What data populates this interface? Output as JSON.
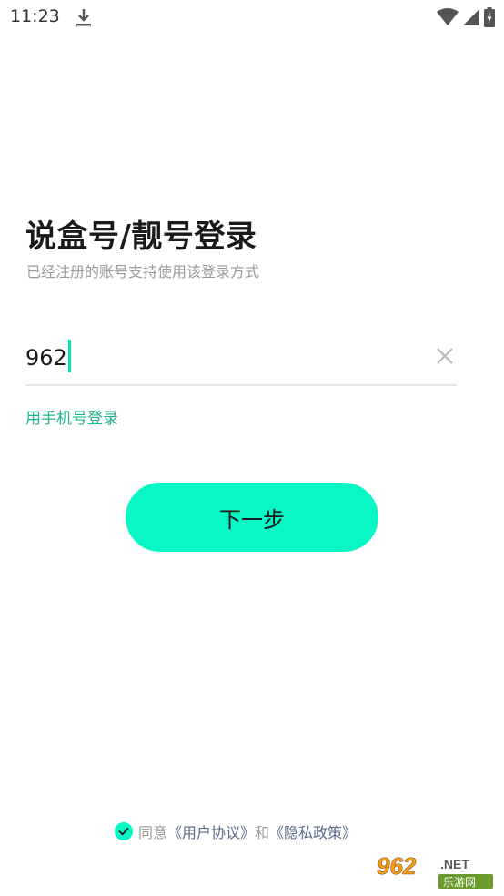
{
  "status_bar": {
    "time": "11:23",
    "icons": [
      "download-icon",
      "wifi-icon",
      "signal-icon",
      "battery-icon"
    ]
  },
  "login": {
    "title": "说盒号/靓号登录",
    "subtitle": "已经注册的账号支持使用该登录方式",
    "account_input": {
      "value": "962",
      "placeholder": ""
    },
    "phone_login_label": "用手机号登录",
    "next_button_label": "下一步"
  },
  "agreement": {
    "checked": true,
    "prefix": "同意",
    "user_agreement": "《用户协议》",
    "conjunction": "和",
    "privacy_policy": "《隐私政策》"
  },
  "watermark": {
    "logo_number": "962",
    "logo_suffix": ".NET",
    "logo_text": "乐游网"
  },
  "colors": {
    "accent": "#08f7c4",
    "caret": "#08e0b0",
    "link_green": "#22b58c",
    "link_blue_gray": "#5a6a8a",
    "muted_text": "#9a9a9a"
  }
}
